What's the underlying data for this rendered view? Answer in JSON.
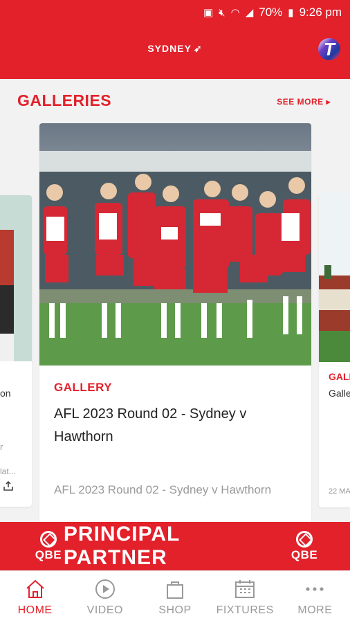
{
  "status_bar": {
    "battery": "70%",
    "time": "9:26 pm"
  },
  "header": {
    "brand": "SYDNEY"
  },
  "galleries": {
    "title": "GALLERIES",
    "see_more": "SEE MORE ▸",
    "main_card": {
      "tag": "GALLERY",
      "headline": "AFL 2023 Round 02 - Sydney v Hawthorn",
      "summary": "AFL 2023 Round 02 - Sydney v Hawthorn"
    },
    "left_card": {
      "line1": "on",
      "line2": "r",
      "line3": "lat..."
    },
    "right_card": {
      "tag": "GALL",
      "line1": "Galle",
      "date": "22 MA"
    }
  },
  "sponsor": {
    "left_logo": "QBE",
    "text": "PRINCIPAL PARTNER",
    "right_logo": "QBE"
  },
  "bottom_nav": {
    "items": [
      {
        "label": "HOME",
        "icon": "home-icon",
        "active": true
      },
      {
        "label": "VIDEO",
        "icon": "play-icon",
        "active": false
      },
      {
        "label": "SHOP",
        "icon": "shopping-bag-icon",
        "active": false
      },
      {
        "label": "FIXTURES",
        "icon": "calendar-icon",
        "active": false
      },
      {
        "label": "MORE",
        "icon": "more-dots-icon",
        "active": false
      }
    ]
  },
  "colors": {
    "brand_red": "#e2212b",
    "inactive_grey": "#999999"
  }
}
